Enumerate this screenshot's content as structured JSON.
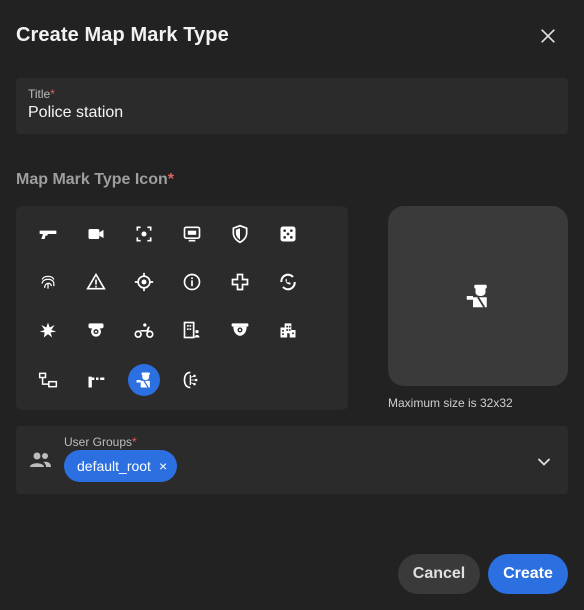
{
  "dialog": {
    "title": "Create Map Mark Type",
    "close_icon": "close-icon"
  },
  "title_field": {
    "label": "Title",
    "required_mark": "*",
    "value": "Police station"
  },
  "icon_section": {
    "label": "Map Mark Type Icon",
    "required_mark": "*",
    "selected_icon": "police-officer-icon",
    "icons": [
      "pistol-icon",
      "video-camera-icon",
      "focus-frame-icon",
      "monitor-icon",
      "shield-icon",
      "dice-icon",
      "fingerprint-icon",
      "warning-icon",
      "target-icon",
      "info-icon",
      "medical-cross-icon",
      "phone-sync-icon",
      "explosion-icon",
      "security-camera-icon",
      "motorcycle-icon",
      "building-person-icon",
      "dome-camera-icon",
      "city-buildings-icon",
      "network-icon",
      "barrier-gate-icon",
      "police-officer-icon",
      "face-scan-icon"
    ]
  },
  "preview": {
    "icon": "police-officer-icon",
    "max_size_text": "Maximum size is 32x32"
  },
  "user_groups": {
    "label": "User Groups",
    "required_mark": "*",
    "chips": [
      "default_root"
    ],
    "remove_glyph": "×"
  },
  "actions": {
    "cancel_label": "Cancel",
    "create_label": "Create"
  },
  "colors": {
    "background": "#222222",
    "field_bg": "#2b2b2b",
    "accent": "#2b6fe0",
    "required": "#e06060"
  }
}
